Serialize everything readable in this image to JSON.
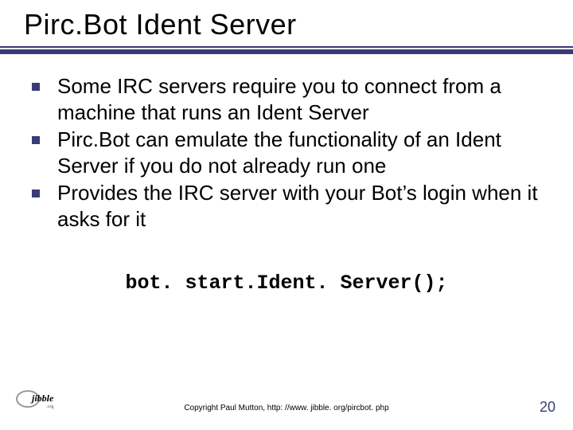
{
  "title": "Pirc.Bot Ident Server",
  "bullets": [
    "Some IRC servers require you to connect from a machine that runs an Ident Server",
    "Pirc.Bot can emulate the functionality of an Ident Server if you do not already run one",
    "Provides the IRC server with your Bot’s login when it asks for it"
  ],
  "code": "bot. start.Ident. Server();",
  "copyright": "Copyright Paul Mutton, http: //www. jibble. org/pircbot. php",
  "page_number": "20",
  "logo_text": "jibble",
  "logo_sub": ".org"
}
